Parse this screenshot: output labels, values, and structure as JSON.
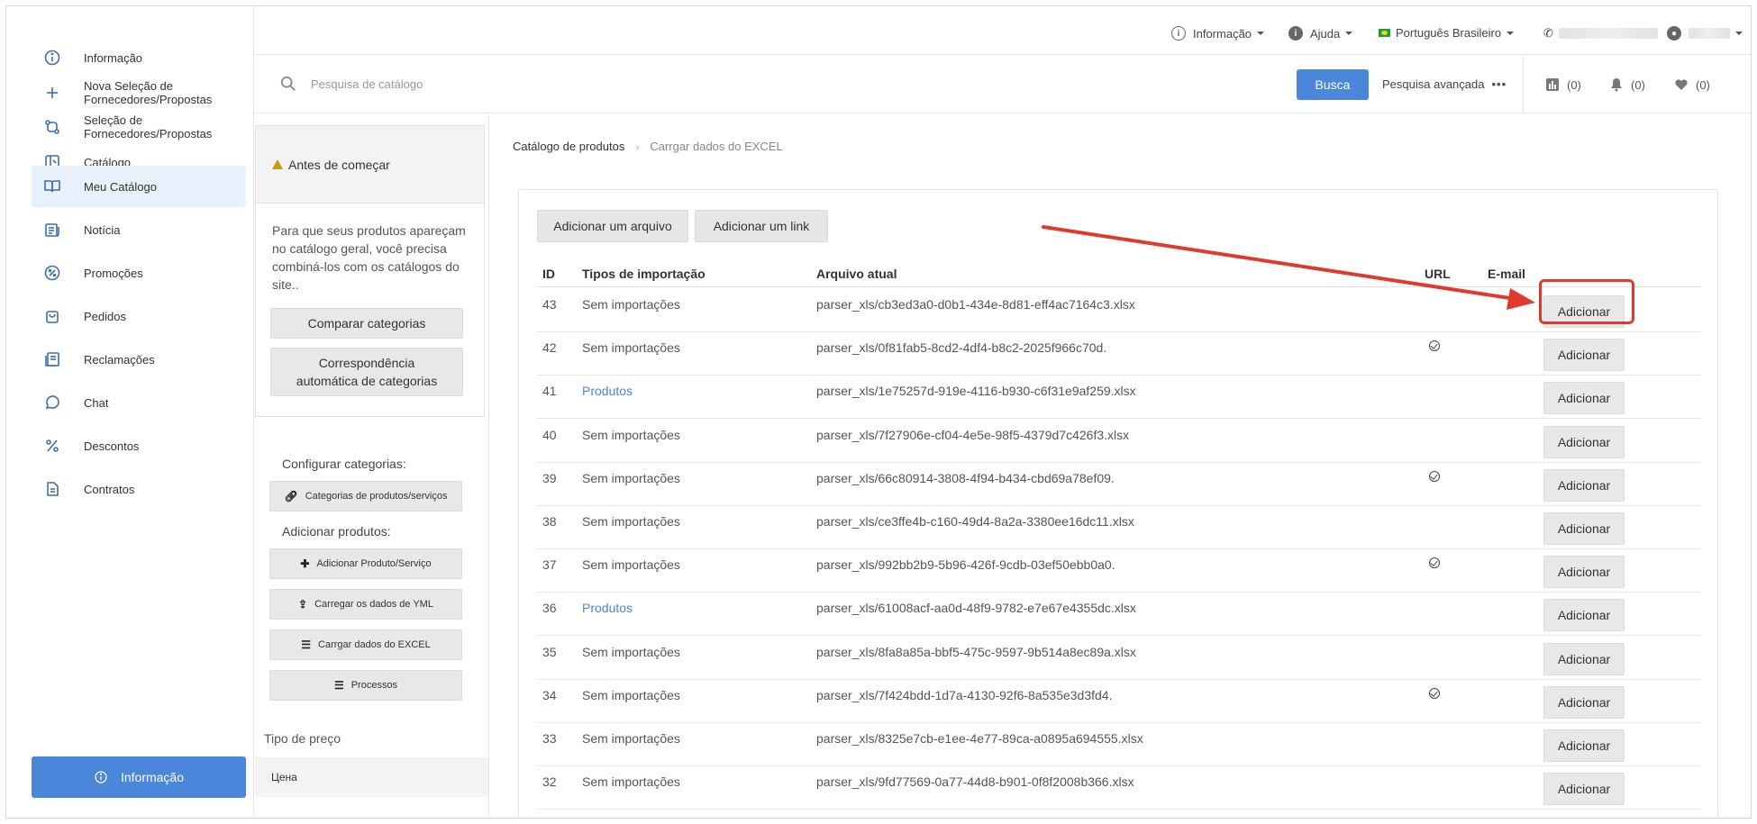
{
  "nav": {
    "items": [
      {
        "label": "Informação",
        "icon": "info-icon"
      },
      {
        "label": "Nova Seleção de Fornecedores/Propostas",
        "icon": "plus-icon"
      },
      {
        "label": "Seleção de Fornecedores/Propostas",
        "icon": "swap-icon"
      },
      {
        "label": "Catálogo",
        "icon": "catalog-icon"
      },
      {
        "label": "Meu Catálogo",
        "icon": "book-icon"
      },
      {
        "label": "Notícia",
        "icon": "news-icon"
      },
      {
        "label": "Promoções",
        "icon": "percent-badge-icon"
      },
      {
        "label": "Pedidos",
        "icon": "bag-icon"
      },
      {
        "label": "Reclamações",
        "icon": "complaint-icon"
      },
      {
        "label": "Chat",
        "icon": "chat-icon"
      },
      {
        "label": "Descontos",
        "icon": "percent-icon"
      },
      {
        "label": "Contratos",
        "icon": "contract-icon"
      }
    ],
    "nav_line1": [
      "Informação",
      "Nova Seleção de",
      "Seleção de",
      "Catálogo",
      "Meu Catálogo",
      "Notícia",
      "Promoções",
      "Pedidos",
      "Reclamações",
      "Chat",
      "Descontos",
      "Contratos"
    ],
    "nav_line2": [
      "",
      "Fornecedores/Propostas",
      "Fornecedores/Propostas",
      "",
      "",
      "",
      "",
      "",
      "",
      "",
      "",
      ""
    ],
    "active_item": "Meu Catálogo",
    "bottom_button": "Informação"
  },
  "topbar": {
    "info_menu": "Informação",
    "help_menu": "Ajuda",
    "language_menu": "Português Brasileiro"
  },
  "search": {
    "placeholder": "Pesquisa de catálogo",
    "button": "Busca",
    "advanced": "Pesquisa avançada",
    "advanced_dots": "•••",
    "stats_count": "(0)",
    "notifications_count": "(0)",
    "favorites_count": "(0)"
  },
  "sidebar": {
    "before_start_title": "Antes de começar",
    "before_start_text": "Para que seus produtos apareçam no catálogo geral, você precisa combiná-los com os catálogos do site..",
    "compare_button": "Comparar categorias",
    "auto_match_button": "Correspondência automática de categorias",
    "configure_label": "Configurar categorias:",
    "categories_button": "Categorias de produtos/serviços",
    "add_products_label": "Adicionar produtos:",
    "add_product_button": "Adicionar Produto/Serviço",
    "yml_button": "Carregar os dados de YML",
    "excel_button": "Carrgar dados do EXCEL",
    "processes_button": "Processos",
    "price_type_label": "Tipo de preço",
    "price_type_value": "Цена"
  },
  "breadcrumb": {
    "root": "Catálogo de produtos",
    "separator": "›",
    "current": "Carrgar dados do EXCEL"
  },
  "toolbar": {
    "add_file": "Adicionar um arquivo",
    "add_link": "Adicionar um link"
  },
  "table": {
    "headers": {
      "id": "ID",
      "type": "Tipos de importação",
      "file": "Arquivo atual",
      "url": "URL",
      "email": "E-mail"
    },
    "action_label": "Adicionar",
    "rows": [
      {
        "id": "43",
        "type": "Sem importações",
        "file": "parser_xls/cb3ed3a0-d0b1-434e-8d81-eff4ac7164c3.xlsx",
        "url": false,
        "link": false
      },
      {
        "id": "42",
        "type": "Sem importações",
        "file": "parser_xls/0f81fab5-8cd2-4df4-b8c2-2025f966c70d.",
        "url": true,
        "link": false
      },
      {
        "id": "41",
        "type": "Produtos",
        "file": "parser_xls/1e75257d-919e-4116-b930-c6f31e9af259.xlsx",
        "url": false,
        "link": true
      },
      {
        "id": "40",
        "type": "Sem importações",
        "file": "parser_xls/7f27906e-cf04-4e5e-98f5-4379d7c426f3.xlsx",
        "url": false,
        "link": false
      },
      {
        "id": "39",
        "type": "Sem importações",
        "file": "parser_xls/66c80914-3808-4f94-b434-cbd69a78ef09.",
        "url": true,
        "link": false
      },
      {
        "id": "38",
        "type": "Sem importações",
        "file": "parser_xls/ce3ffe4b-c160-49d4-8a2a-3380ee16dc11.xlsx",
        "url": false,
        "link": false
      },
      {
        "id": "37",
        "type": "Sem importações",
        "file": "parser_xls/992bb2b9-5b96-426f-9cdb-03ef50ebb0a0.",
        "url": true,
        "link": false
      },
      {
        "id": "36",
        "type": "Produtos",
        "file": "parser_xls/61008acf-aa0d-48f9-9782-e7e67e4355dc.xlsx",
        "url": false,
        "link": true
      },
      {
        "id": "35",
        "type": "Sem importações",
        "file": "parser_xls/8fa8a85a-bbf5-475c-9597-9b514a8ec89a.xlsx",
        "url": false,
        "link": false
      },
      {
        "id": "34",
        "type": "Sem importações",
        "file": "parser_xls/7f424bdd-1d7a-4130-92f6-8a535e3d3fd4.",
        "url": true,
        "link": false
      },
      {
        "id": "33",
        "type": "Sem importações",
        "file": "parser_xls/8325e7cb-e1ee-4e77-89ca-a0895a694555.xlsx",
        "url": false,
        "link": false
      },
      {
        "id": "32",
        "type": "Sem importações",
        "file": "parser_xls/9fd77569-0a77-44d8-b901-0f8f2008b366.xlsx",
        "url": false,
        "link": false
      }
    ]
  },
  "annotation_color": "#e03a2e",
  "accent_color": "#4a86d9"
}
